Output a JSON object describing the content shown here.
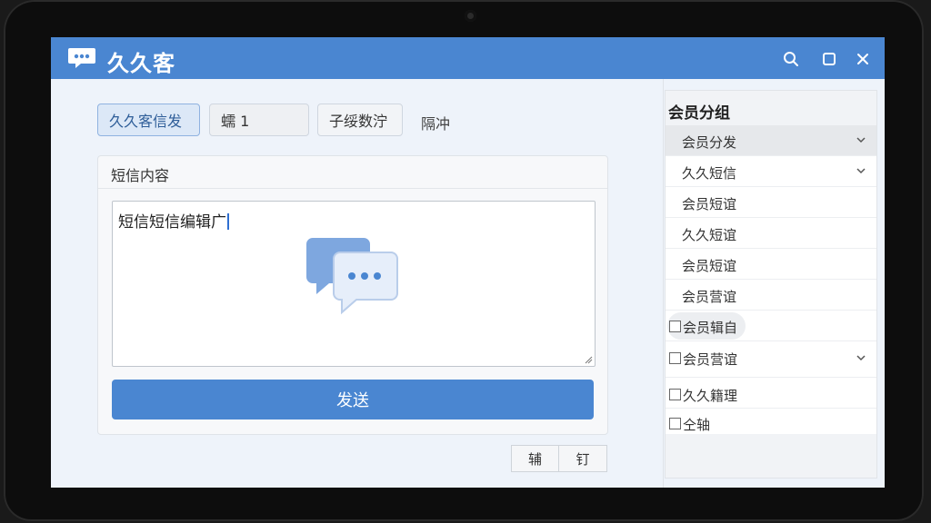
{
  "app": {
    "title": "久久客"
  },
  "toolbar": {
    "tab_active": "久久客信发",
    "field_value": "蠕 1",
    "button_label": "子绥数泞",
    "plain_label": "隔冲"
  },
  "panel": {
    "title": "短信内容",
    "editor_text": "短信短信编辑广",
    "send_label": "发送"
  },
  "bottom_buttons": [
    "辅",
    "钉"
  ],
  "sidebar": {
    "title": "会员分组",
    "items": [
      {
        "label": "会员分发",
        "chevron": true,
        "checkbox": false,
        "selected": true
      },
      {
        "label": "久久短信",
        "chevron": true,
        "checkbox": false,
        "selected": false
      },
      {
        "label": "会员短谊",
        "chevron": false,
        "checkbox": false,
        "selected": false
      },
      {
        "label": "久久短谊",
        "chevron": false,
        "checkbox": false,
        "selected": false
      },
      {
        "label": "会员短谊",
        "chevron": false,
        "checkbox": false,
        "selected": false
      },
      {
        "label": "会员营谊",
        "chevron": false,
        "checkbox": false,
        "selected": false
      },
      {
        "label": "会员辑自",
        "chevron": false,
        "checkbox": true,
        "selected": false
      },
      {
        "label": "会员营谊",
        "chevron": true,
        "checkbox": true,
        "selected": false
      },
      {
        "label": "久久籍理",
        "chevron": false,
        "checkbox": true,
        "selected": false
      },
      {
        "label": "仝轴",
        "chevron": false,
        "checkbox": true,
        "selected": false
      }
    ]
  },
  "colors": {
    "accent": "#4a86d1",
    "screen_bg": "#eef3fa"
  },
  "icons": [
    "chat-bubble-icon",
    "search-icon",
    "maximize-icon",
    "close-icon",
    "chevron-down-icon",
    "chat-illustration-icon",
    "resize-handle-icon",
    "checkbox-icon"
  ]
}
